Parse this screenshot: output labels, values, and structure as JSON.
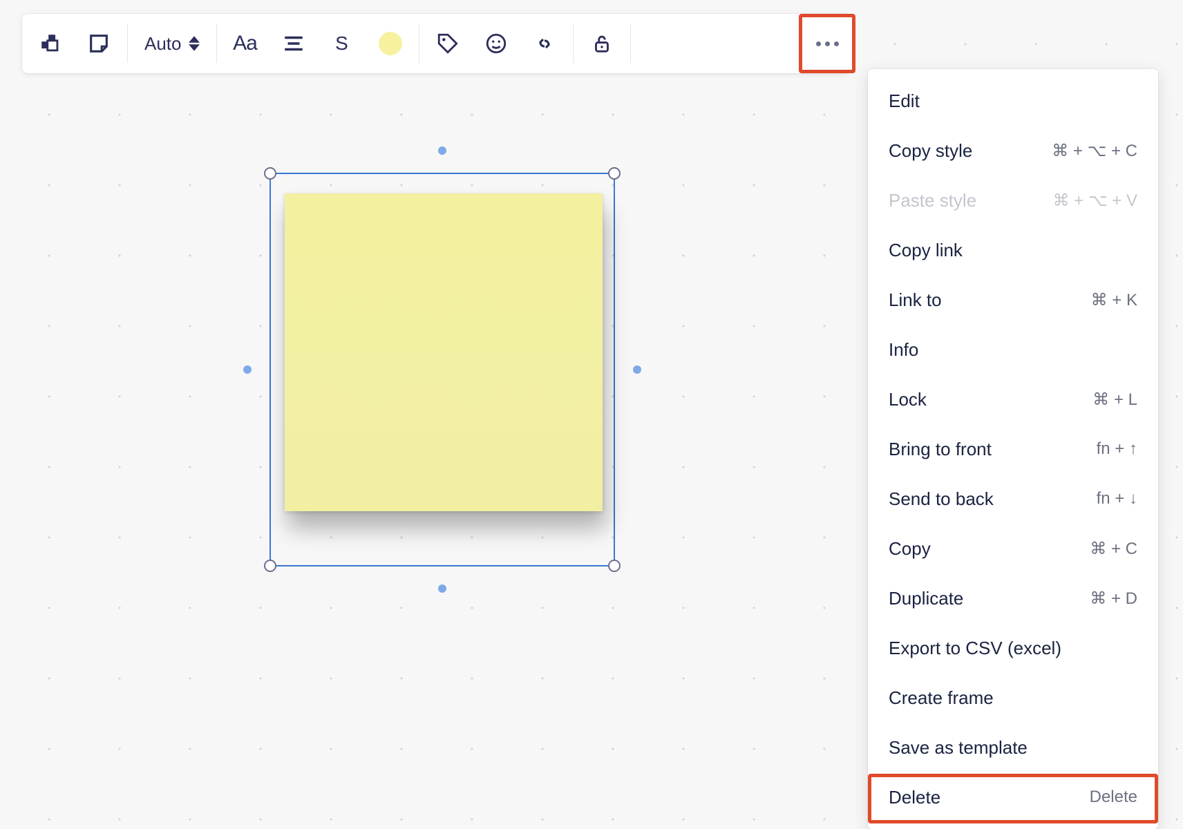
{
  "toolbar": {
    "size_label": "Auto",
    "text_format_label": "Aa",
    "text_size_label": "S",
    "swatch_color": "#f5f19f"
  },
  "context_menu": {
    "items": [
      {
        "label": "Edit",
        "shortcut": "",
        "disabled": false
      },
      {
        "label": "Copy style",
        "shortcut": "⌘ + ⌥ + C",
        "disabled": false
      },
      {
        "label": "Paste style",
        "shortcut": "⌘ + ⌥ + V",
        "disabled": true
      },
      {
        "label": "Copy link",
        "shortcut": "",
        "disabled": false
      },
      {
        "label": "Link to",
        "shortcut": "⌘ + K",
        "disabled": false
      },
      {
        "label": "Info",
        "shortcut": "",
        "disabled": false
      },
      {
        "label": "Lock",
        "shortcut": "⌘ + L",
        "disabled": false
      },
      {
        "label": "Bring to front",
        "shortcut": "fn + ↑",
        "disabled": false
      },
      {
        "label": "Send to back",
        "shortcut": "fn + ↓",
        "disabled": false
      },
      {
        "label": "Copy",
        "shortcut": "⌘ + C",
        "disabled": false
      },
      {
        "label": "Duplicate",
        "shortcut": "⌘ + D",
        "disabled": false
      },
      {
        "label": "Export to CSV (excel)",
        "shortcut": "",
        "disabled": false
      },
      {
        "label": "Create frame",
        "shortcut": "",
        "disabled": false
      },
      {
        "label": "Save as template",
        "shortcut": "",
        "disabled": false
      },
      {
        "label": "Delete",
        "shortcut": "Delete",
        "disabled": false
      }
    ]
  }
}
